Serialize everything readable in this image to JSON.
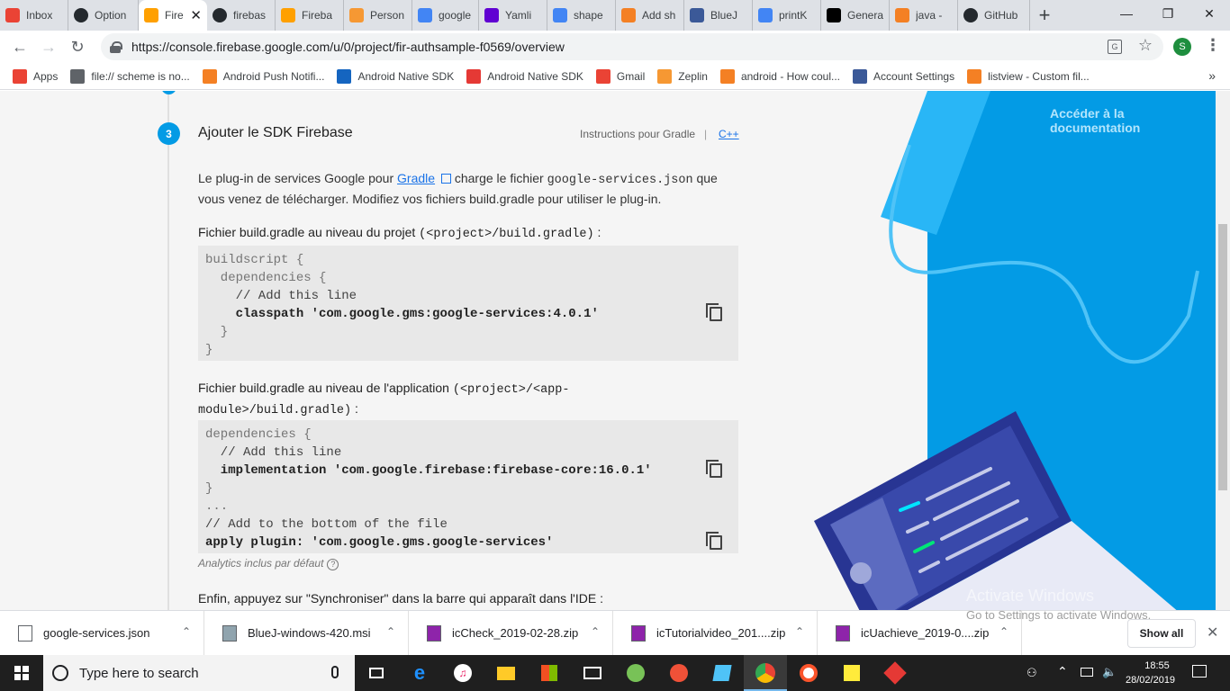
{
  "browser": {
    "tabs": [
      {
        "label": "Inbox",
        "icon": "gmail-icon",
        "color": "#ea4335"
      },
      {
        "label": "Option",
        "icon": "github-icon",
        "color": "#24292e"
      },
      {
        "label": "Fire",
        "icon": "firebase-icon",
        "color": "#ffa000",
        "active": true
      },
      {
        "label": "firebas",
        "icon": "github-icon",
        "color": "#24292e"
      },
      {
        "label": "Fireba",
        "icon": "firebase-icon",
        "color": "#ffa000"
      },
      {
        "label": "Person",
        "icon": "zeplin-icon",
        "color": "#f69833"
      },
      {
        "label": "google",
        "icon": "google-icon",
        "color": "#4285f4"
      },
      {
        "label": "Yamli",
        "icon": "yahoo-icon",
        "color": "#6001d2"
      },
      {
        "label": "shape",
        "icon": "google-icon",
        "color": "#4285f4"
      },
      {
        "label": "Add sh",
        "icon": "stackoverflow-icon",
        "color": "#f48024"
      },
      {
        "label": "BlueJ",
        "icon": "bluej-icon",
        "color": "#3b5998"
      },
      {
        "label": "printK",
        "icon": "google-icon",
        "color": "#4285f4"
      },
      {
        "label": "Genera",
        "icon": "medium-icon",
        "color": "#000000"
      },
      {
        "label": "java -",
        "icon": "stackoverflow-icon",
        "color": "#f48024"
      },
      {
        "label": "GitHub",
        "icon": "github-icon",
        "color": "#24292e"
      }
    ],
    "url": "https://console.firebase.google.com/u/0/project/fir-authsample-f0569/overview",
    "profile_initial": "S",
    "bookmarks": [
      {
        "label": "Apps",
        "icon": "apps-grid-icon"
      },
      {
        "label": "file:// scheme is no...",
        "icon": "file-icon"
      },
      {
        "label": "Android Push Notifi...",
        "icon": "stackoverflow-icon"
      },
      {
        "label": "Android Native SDK",
        "icon": "book-icon"
      },
      {
        "label": "Android Native SDK",
        "icon": "target-icon"
      },
      {
        "label": "Gmail",
        "icon": "gmail-icon"
      },
      {
        "label": "Zeplin",
        "icon": "zeplin-icon"
      },
      {
        "label": "android - How coul...",
        "icon": "stackoverflow-icon"
      },
      {
        "label": "Account Settings",
        "icon": "facebook-icon"
      },
      {
        "label": "listview - Custom fil...",
        "icon": "stackoverflow-icon"
      }
    ],
    "more_bookmarks": "»"
  },
  "page": {
    "step_number": "3",
    "step_title": "Ajouter le SDK Firebase",
    "instructions_label": "Instructions pour Gradle",
    "separator": "|",
    "cpp_link": "C++",
    "intro_pre": "Le plug-in de services Google pour ",
    "intro_link": "Gradle",
    "intro_mid": " charge le fichier ",
    "intro_file": "google-services.json",
    "intro_post": " que vous venez de télécharger. Modifiez vos fichiers build.gradle pour utiliser le plug-in.",
    "project_label_bold": "Fichier build.gradle au niveau du projet",
    "project_label_path": "(<project>/build.gradle)",
    "project_label_end": " :",
    "project_code": {
      "l1": "buildscript {",
      "l2": "  dependencies {",
      "l3": "    // Add this line",
      "l4": "    classpath 'com.google.gms:google-services:4.0.1'",
      "l5": "  }",
      "l6": "}"
    },
    "app_label_bold": "Fichier build.gradle au niveau de l'application",
    "app_label_path1": "(<project>/<app-",
    "app_label_path2": "module>/build.gradle)",
    "app_label_end": " :",
    "app_code": {
      "l1": "dependencies {",
      "l2": "  // Add this line",
      "l3": "  implementation 'com.google.firebase:firebase-core:16.0.1'",
      "l4": "}",
      "l5": "...",
      "l6": "// Add to the bottom of the file",
      "l7": "apply plugin: 'com.google.gms.google-services'"
    },
    "analytics_note": "Analytics inclus par défaut",
    "sync_text": "Enfin, appuyez sur \"Synchroniser\" dans la barre qui apparaît dans l'IDE :",
    "docs_link": "Accéder à la documentation",
    "activate_title": "Activate Windows",
    "activate_sub": "Go to Settings to activate Windows."
  },
  "downloads": {
    "items": [
      {
        "name": "google-services.json",
        "icon": "file-icon"
      },
      {
        "name": "BlueJ-windows-420.msi",
        "icon": "installer-icon"
      },
      {
        "name": "icCheck_2019-02-28.zip",
        "icon": "winrar-icon"
      },
      {
        "name": "icTutorialvideo_201....zip",
        "icon": "winrar-icon"
      },
      {
        "name": "icUachieve_2019-0....zip",
        "icon": "winrar-icon"
      }
    ],
    "show_all": "Show all"
  },
  "taskbar": {
    "search_placeholder": "Type here to search",
    "time": "18:55",
    "date": "28/02/2019"
  },
  "colors": {
    "accent": "#039be5",
    "link": "#1a73e8",
    "firebase": "#ffa000"
  }
}
